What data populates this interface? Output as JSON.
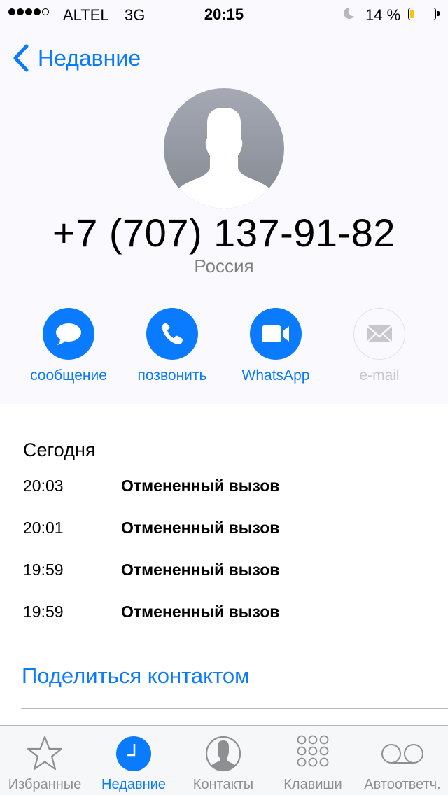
{
  "status_bar": {
    "signal_bars_filled": 4,
    "signal_bars_total": 5,
    "carrier": "ALTEL",
    "network": "3G",
    "time": "20:15",
    "do_not_disturb_icon": "moon-icon",
    "battery_percent_text": "14 %",
    "battery_level": 0.14,
    "battery_color": "#f7c600"
  },
  "nav": {
    "back_label": "Недавние"
  },
  "contact": {
    "phone_number": "+7 (707) 137-91-82",
    "country": "Россия"
  },
  "actions": [
    {
      "label": "сообщение",
      "icon": "message-bubble-icon",
      "enabled": true
    },
    {
      "label": "позвонить",
      "icon": "phone-icon",
      "enabled": true
    },
    {
      "label": "WhatsApp",
      "icon": "video-camera-icon",
      "enabled": true
    },
    {
      "label": "e-mail",
      "icon": "envelope-icon",
      "enabled": false
    }
  ],
  "calls": {
    "section_title": "Сегодня",
    "items": [
      {
        "time": "20:03",
        "status": "Отмененный вызов"
      },
      {
        "time": "20:01",
        "status": "Отмененный вызов"
      },
      {
        "time": "19:59",
        "status": "Отмененный вызов"
      },
      {
        "time": "19:59",
        "status": "Отмененный вызов"
      }
    ]
  },
  "share_contact_label": "Поделиться контактом",
  "tab_bar": {
    "active_index": 1,
    "tabs": [
      {
        "label": "Избранные",
        "icon": "star-icon"
      },
      {
        "label": "Недавние",
        "icon": "clock-icon"
      },
      {
        "label": "Контакты",
        "icon": "contact-icon"
      },
      {
        "label": "Клавиши",
        "icon": "keypad-icon"
      },
      {
        "label": "Автоответч.",
        "icon": "voicemail-icon"
      }
    ]
  },
  "colors": {
    "accent": "#0a7aff",
    "secondary_text": "#7f7f7f",
    "tab_inactive": "#8e8e93",
    "disabled": "#c7c7cc"
  }
}
